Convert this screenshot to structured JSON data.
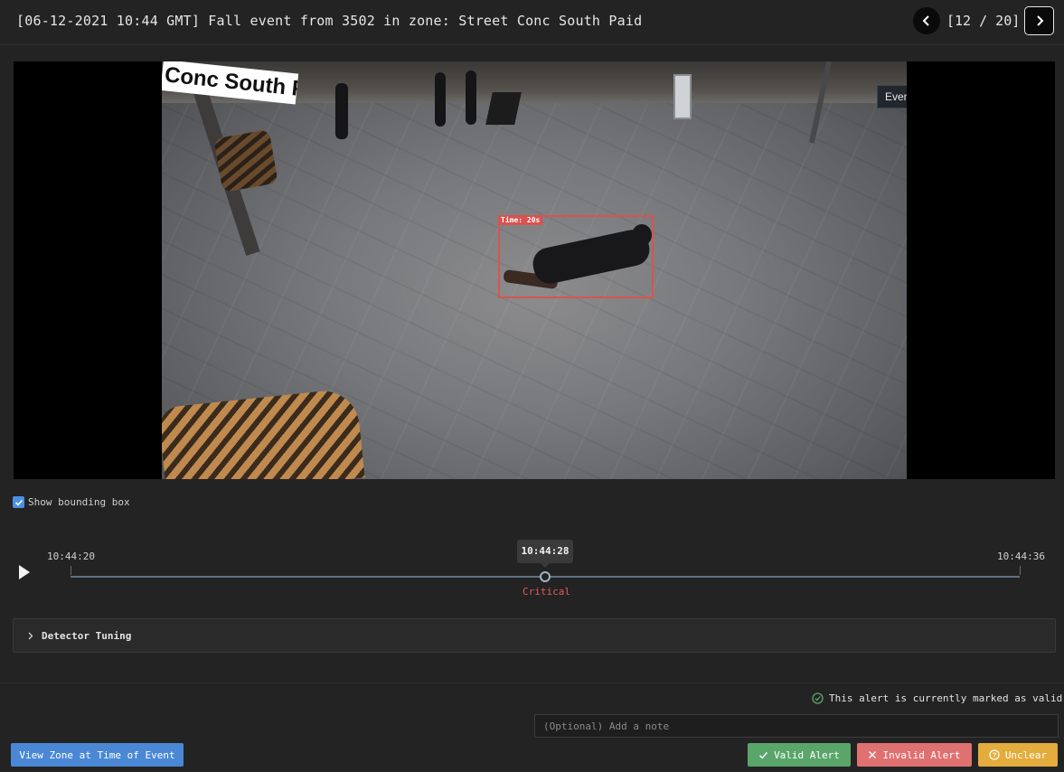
{
  "header": {
    "title": "[06-12-2021 10:44 GMT] Fall event from 3502 in zone: Street Conc South Paid",
    "counter": "[12 / 20]"
  },
  "video": {
    "sign_text": "Conc South Paid",
    "detection_label": "Time: 20s",
    "layer_select": "Events"
  },
  "options": {
    "show_bounding_box": "Show bounding box",
    "show_bounding_box_checked": true
  },
  "timeline": {
    "start": "10:44:20",
    "end": "10:44:36",
    "current": "10:44:28",
    "severity": "Critical",
    "severity_color": "#e05d5d",
    "position": 0.5
  },
  "tuning": {
    "label": "Detector Tuning"
  },
  "footer": {
    "status": "This alert is currently marked as valid",
    "note_placeholder": "(Optional) Add a note",
    "view_zone": "View Zone at Time of Event",
    "valid": "Valid Alert",
    "invalid": "Invalid Alert",
    "unclear": "Unclear"
  },
  "colors": {
    "background": "#232323",
    "accent_blue": "#4a88d6",
    "valid_green": "#5aa66a",
    "invalid_red": "#e07171",
    "unclear_amber": "#e3ac3c",
    "bbox_red": "#d9534f"
  },
  "icons": [
    "chevron-left-icon",
    "chevron-right-icon",
    "chevron-down-icon",
    "play-icon",
    "check-icon",
    "check-circle-icon",
    "x-icon",
    "question-circle-icon"
  ]
}
